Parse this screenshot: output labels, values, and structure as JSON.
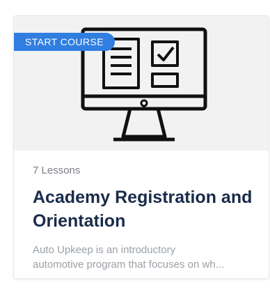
{
  "card": {
    "badge_label": "START COURSE",
    "lessons_count": "7 Lessons",
    "title": "Academy Registration and Orientation",
    "description_line1": "Auto Upkeep is an introductory",
    "description_line2": "automotive program that focuses on wh...",
    "thumbnail_icon": "computer-monitor-form-icon"
  },
  "colors": {
    "badge_bg": "#2f7ee0",
    "title": "#1a2b4a",
    "thumb_bg": "#f2f2f3"
  }
}
